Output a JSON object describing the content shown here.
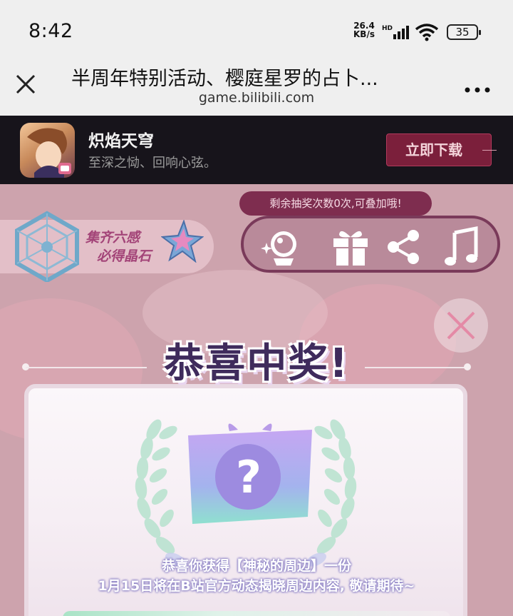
{
  "status_bar": {
    "time": "8:42",
    "net_speed_value": "26.4",
    "net_speed_unit": "KB/s",
    "network_badge": "HD",
    "battery": "35"
  },
  "title_bar": {
    "title": "半周年特别活动、樱庭星罗的占卜...",
    "domain": "game.bilibili.com"
  },
  "app_banner": {
    "name": "炽焰天穹",
    "slogan": "至深之恸、回响心弦。",
    "download_label": "立即下载"
  },
  "game": {
    "chance_text": "剩余抽奖次数0次,可叠加哦!",
    "six_senses_line1": "集齐六感",
    "six_senses_line2": "必得晶石",
    "toolbar_icons": [
      "crystal-ball-icon",
      "gift-icon",
      "share-icon",
      "music-icon"
    ],
    "popup_title": "恭喜中奖!",
    "prize_line1": "恭喜你获得【神秘的周边】一份",
    "prize_line2": "1月15日将在B站官方动态揭晓周边内容, 敬请期待~",
    "mystery_mark": "?"
  },
  "colors": {
    "banner_bg": "#17141b",
    "download_btn": "#7b1f3b",
    "game_bg": "#cda3ad",
    "title_text": "#3f2b5c"
  }
}
